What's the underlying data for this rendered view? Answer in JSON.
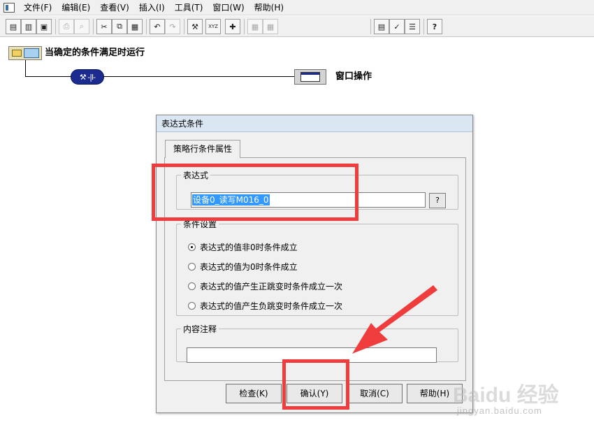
{
  "menu": {
    "items": [
      {
        "label": "文件(F)"
      },
      {
        "label": "编辑(E)"
      },
      {
        "label": "查看(V)"
      },
      {
        "label": "插入(I)"
      },
      {
        "label": "工具(T)"
      },
      {
        "label": "窗口(W)"
      },
      {
        "label": "帮助(H)"
      }
    ]
  },
  "toolbar": {
    "new_label": "▤",
    "open_label": "▥",
    "save_label": "▣",
    "print_label": "⎙",
    "preview_label": "⌕",
    "cut_label": "✂",
    "copy_label": "⧉",
    "paste_label": "▦",
    "undo_label": "↶",
    "redo_label": "↷",
    "tools_label": "⚒",
    "xyz_label": "XYZ",
    "add_label": "✚",
    "grid1_label": "▦",
    "grid2_label": "▦",
    "props_label": "▤",
    "check_label": "✓",
    "list_label": "☰",
    "help_label": "?"
  },
  "strategy": {
    "title": "当确定的条件满足时运行",
    "condition_symbol": "⚒ -|I-",
    "window_title": "窗口操作"
  },
  "dialog": {
    "title": "表达式条件",
    "tab_label": "策略行条件属性",
    "expression_group": "表达式",
    "expression_value": "设备0_读写M016_0",
    "help_button": "?",
    "condition_group": "条件设置",
    "options": [
      {
        "label": "表达式的值非0时条件成立",
        "checked": true
      },
      {
        "label": "表达式的值为0时条件成立",
        "checked": false
      },
      {
        "label": "表达式的值产生正跳变时条件成立一次",
        "checked": false
      },
      {
        "label": "表达式的值产生负跳变时条件成立一次",
        "checked": false
      }
    ],
    "comment_group": "内容注释",
    "comment_value": "",
    "buttons": {
      "check": "检查(K)",
      "ok": "确认(Y)",
      "cancel": "取消(C)",
      "help": "帮助(H)"
    }
  },
  "watermark": {
    "main": "Baidu 经验",
    "sub": "jingyan.baidu.com"
  },
  "colors": {
    "annotation_red": "#ef3c3c",
    "condition_blue": "#1b2c8e"
  }
}
